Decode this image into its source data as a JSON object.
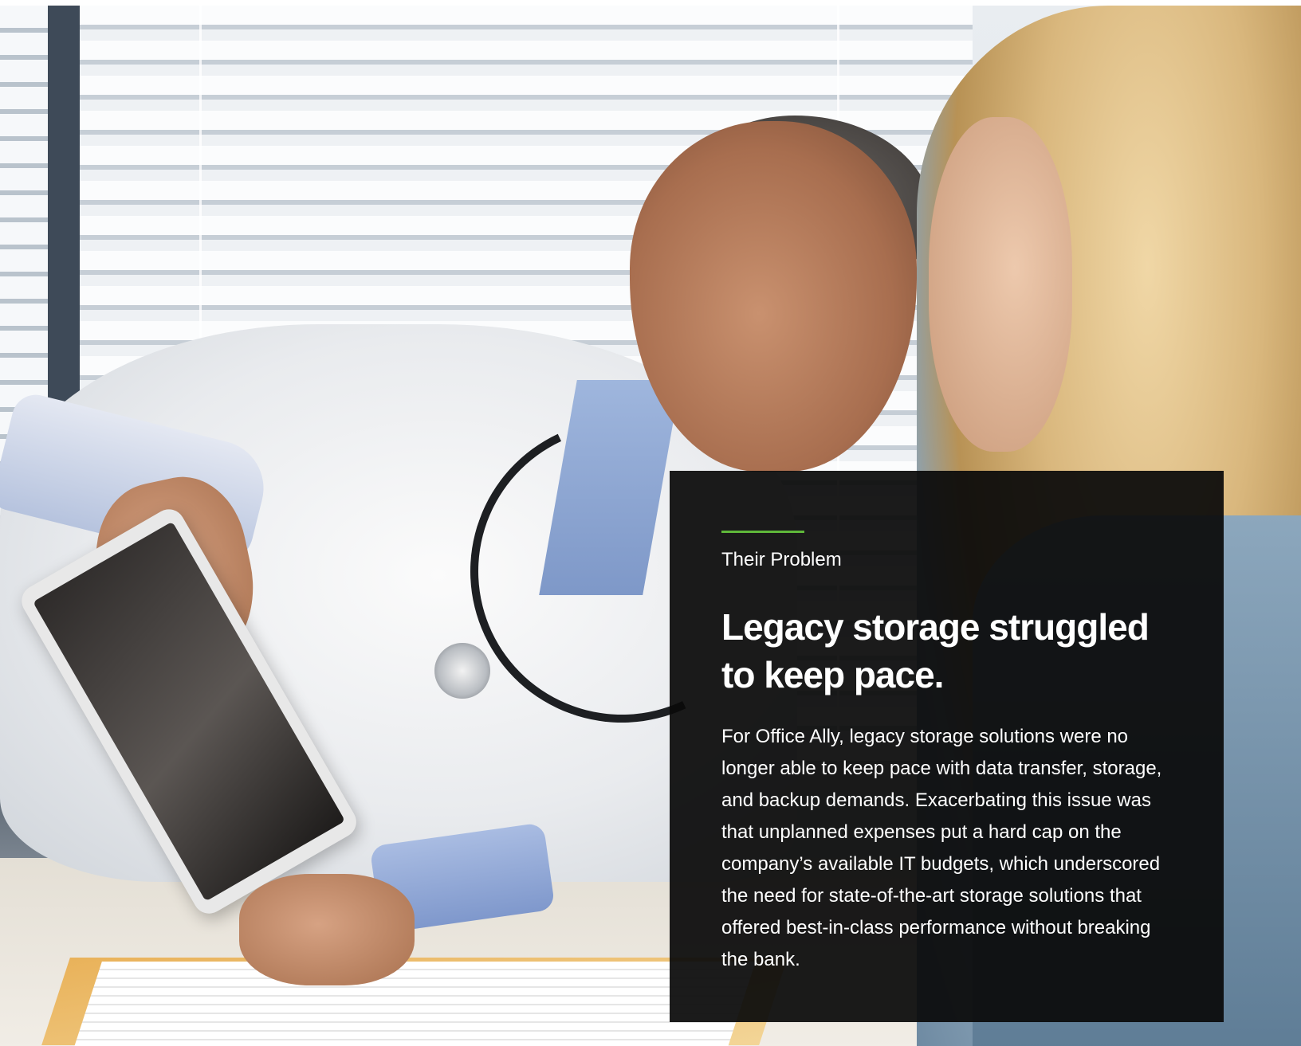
{
  "card": {
    "eyebrow": "Their Problem",
    "headline": "Legacy storage struggled to keep pace.",
    "body": "For Office Ally, legacy storage solutions were no longer able to keep pace with data transfer, storage, and backup demands. Exacerbating this issue was that unplanned expenses put a hard cap on the company’s available IT budgets, which underscored the need for state-of-the-art storage solutions that offered best-in-class performance without breaking the bank."
  },
  "colors": {
    "card_background": "#0a0a0a",
    "accent": "#5fb83a",
    "text": "#ffffff"
  },
  "image": {
    "description_icon": "photo-doctor-patient-tablet"
  }
}
